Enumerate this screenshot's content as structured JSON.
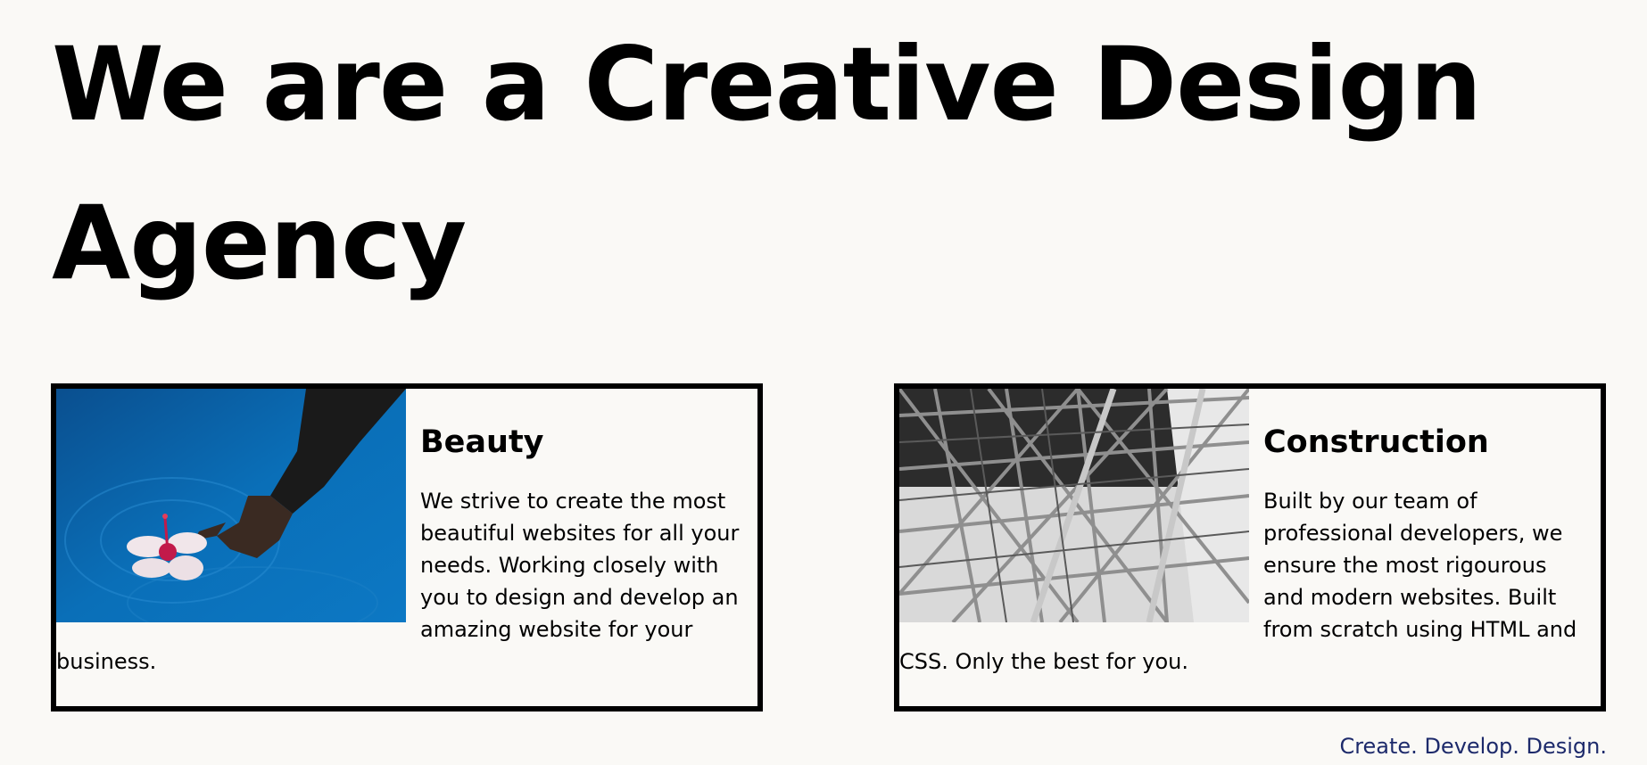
{
  "hero": {
    "title": "We are a Creative Design Agency"
  },
  "cards": [
    {
      "title": "Beauty",
      "text": "We strive to create the most beautiful websites for all your needs. Working closely with you to design and develop an amazing website for your business.",
      "image_icon": "flower-in-water-photo"
    },
    {
      "title": "Construction",
      "text": "Built by our team of professional developers, we ensure the most rigourous and modern websites. Built from scratch using HTML and CSS. Only the best for you.",
      "image_icon": "steel-structure-photo"
    }
  ],
  "footer": {
    "tagline": "Create. Develop. Design."
  },
  "colors": {
    "background": "#faf9f6",
    "text": "#000000",
    "tagline": "#1d2a6b",
    "water": "#0a6fb8"
  }
}
